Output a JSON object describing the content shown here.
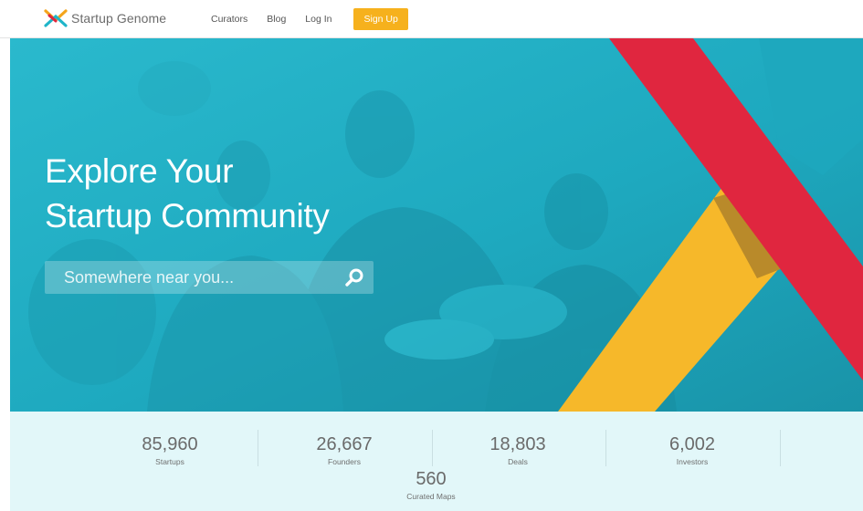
{
  "header": {
    "logo_text": "Startup Genome",
    "nav": {
      "curators": "Curators",
      "blog": "Blog",
      "login": "Log In",
      "signup": "Sign Up"
    }
  },
  "hero": {
    "title_line1": "Explore Your",
    "title_line2": "Startup Community",
    "search": {
      "placeholder": "Somewhere near you...",
      "value": "",
      "icon": "search-icon"
    }
  },
  "stats": [
    {
      "value": "85,960",
      "label": "Startups"
    },
    {
      "value": "26,667",
      "label": "Founders"
    },
    {
      "value": "18,803",
      "label": "Deals"
    },
    {
      "value": "6,002",
      "label": "Investors"
    },
    {
      "value": "560",
      "label": "Curated Maps"
    }
  ],
  "colors": {
    "accent_orange": "#f6b11d",
    "hero_teal": "#21b3c9",
    "ribbon_red": "#e0263f",
    "ribbon_yellow": "#f6b82a",
    "stats_bg": "#e2f7f9"
  }
}
